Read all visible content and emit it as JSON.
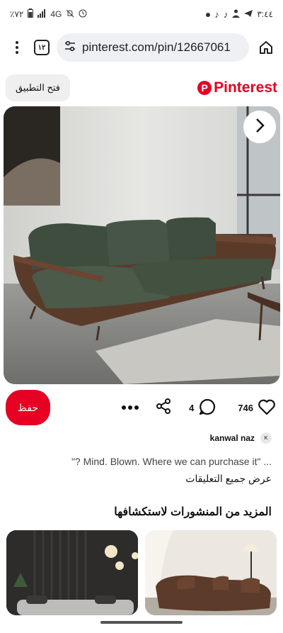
{
  "status_bar": {
    "time": "٣:٤٤",
    "battery": "٪٧٢",
    "network": "4G"
  },
  "browser": {
    "tab_count": "١٢",
    "url": "pinterest.com/pin/12667061"
  },
  "header": {
    "open_app_label": "فتح التطبيق",
    "brand": "Pinterest"
  },
  "pin": {
    "save_label": "حفظ",
    "comment_count": "4",
    "like_count": "746",
    "commenter_initial": "K",
    "commenter_name": "kanwal naz",
    "comment_text": "\"? Mind. Blown. Where we can purchase it\" ...",
    "view_all_comments": "عرض جميع التعليقات"
  },
  "more": {
    "title": "المزيد من المنشورات لاستكشافها"
  },
  "colors": {
    "brand_red": "#e60023",
    "sofa_green": "#3f4d3e",
    "wood": "#5a3b2a"
  },
  "icons": [
    "menu-icon",
    "tabs-icon",
    "site-settings-icon",
    "home-icon",
    "chevron-right-icon",
    "heart-icon",
    "comment-icon",
    "share-icon",
    "more-icon"
  ]
}
